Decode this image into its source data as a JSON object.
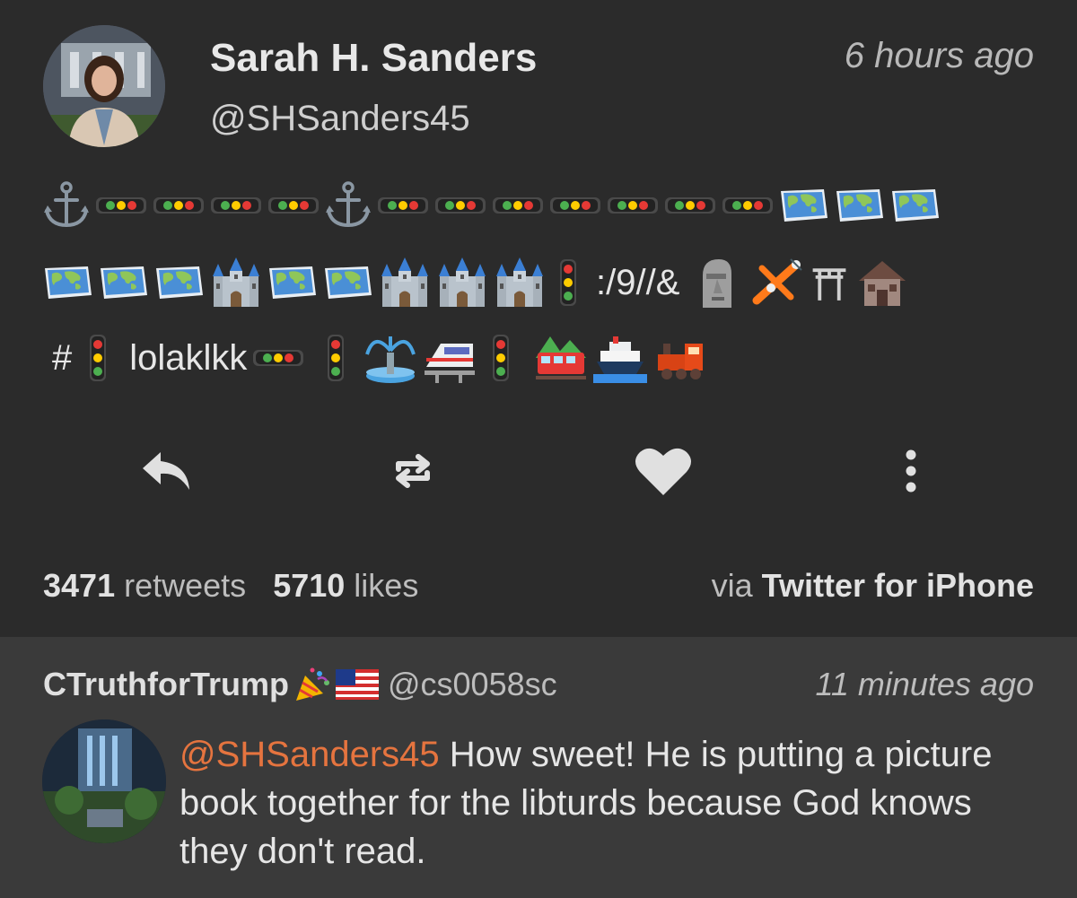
{
  "tweet": {
    "name": "Sarah H. Sanders",
    "handle": "@SHSanders45",
    "time": "6 hours ago",
    "body": {
      "line1": [
        "anchor",
        "traffic-light-h",
        "traffic-light-h",
        "traffic-light-h",
        "traffic-light-h",
        "anchor",
        "traffic-light-h",
        "traffic-light-h",
        "traffic-light-h",
        "traffic-light-h",
        "traffic-light-h",
        "traffic-light-h",
        "traffic-light-h",
        "world-map",
        "world-map",
        "world-map"
      ],
      "line2_text": ":/9//&",
      "line3_hash": "#",
      "line3_text": "lolaklkk"
    },
    "stats": {
      "retweets_count": "3471",
      "retweets_label": "retweets",
      "likes_count": "5710",
      "likes_label": "likes"
    },
    "via_label": "via",
    "via_source": "Twitter for iPhone",
    "actions": [
      "reply-icon",
      "retweet-icon",
      "heart-icon",
      "more-icon"
    ]
  },
  "reply": {
    "name": "CTruthforTrump",
    "handle": "@cs0058sc",
    "time": "11 minutes ago",
    "mention": "@SHSanders45",
    "text": " How sweet!  He is putting a picture book together for the libturds because God knows they don't read."
  },
  "colors": {
    "background": "#2b2b2b",
    "reply_background": "#3a3a3a",
    "mention": "#e5743f"
  }
}
